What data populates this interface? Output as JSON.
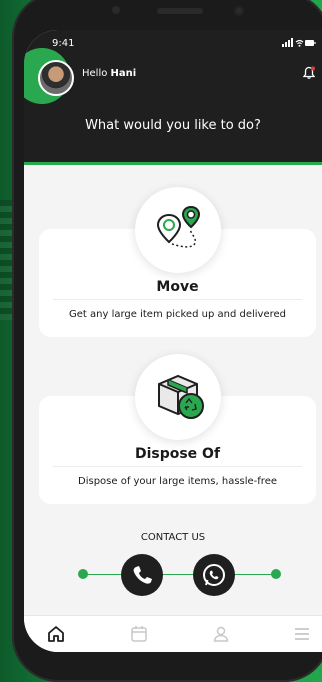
{
  "status_bar": {
    "time": "9:41",
    "icons": "signal-icon wifi-icon battery-icon"
  },
  "header": {
    "greeting": "Hello",
    "user_name": "Hani",
    "question": "What would you like to do?"
  },
  "services": [
    {
      "title": "Move",
      "description": "Get any large item picked up and delivered",
      "icon": "location-pins-icon"
    },
    {
      "title": "Dispose Of",
      "description": "Dispose of your large items, hassle-free",
      "icon": "recycle-box-icon"
    }
  ],
  "contact": {
    "label": "CONTACT US",
    "buttons": [
      "phone-icon",
      "whatsapp-icon"
    ]
  },
  "nav": {
    "items": [
      "home-icon",
      "calendar-icon",
      "profile-icon",
      "menu-icon"
    ]
  },
  "colors": {
    "accent": "#2aa84f",
    "dark": "#1f1f1f",
    "background": "#f4f4f4"
  }
}
